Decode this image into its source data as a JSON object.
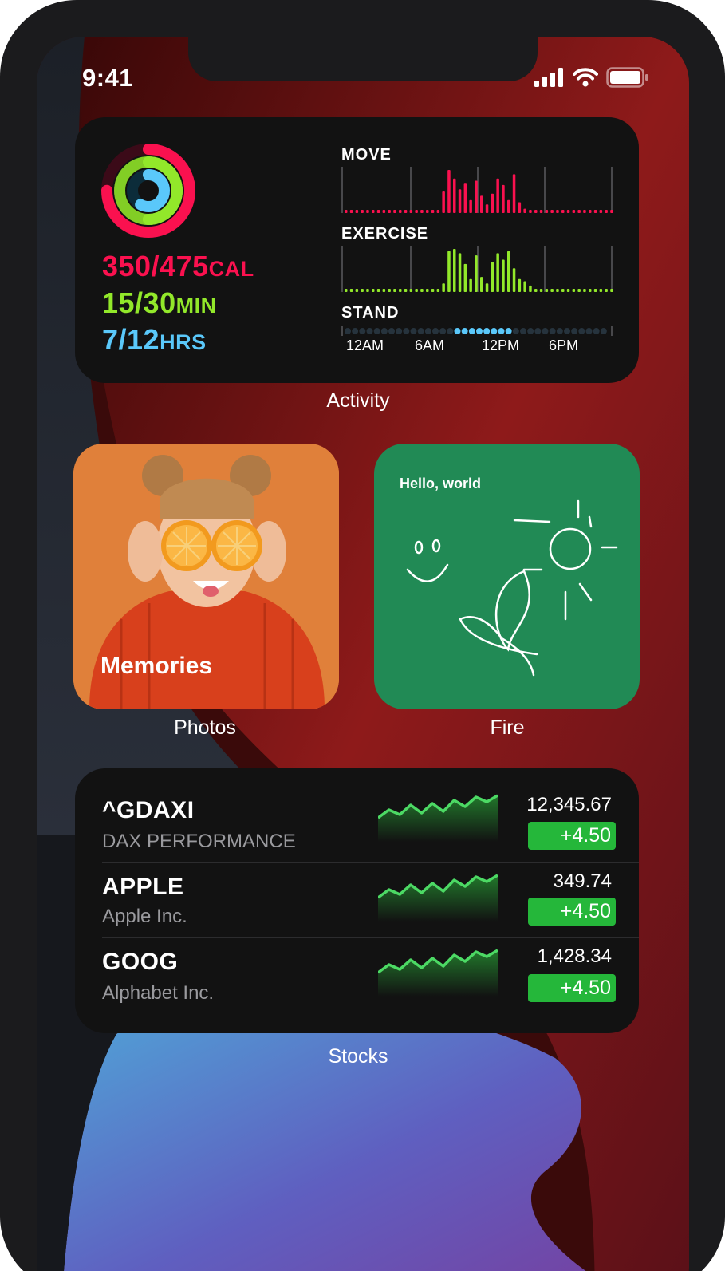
{
  "status_bar": {
    "time": "9:41"
  },
  "activity": {
    "label": "Activity",
    "move": {
      "value": "350/475",
      "unit": "CAL",
      "color": "#fa114f"
    },
    "exercise": {
      "value": "15/30",
      "unit": "MIN",
      "color": "#92e82a"
    },
    "stand": {
      "value": "7/12",
      "unit": "HRS",
      "color": "#5ac8fa"
    },
    "charts": {
      "move_title": "MOVE",
      "exercise_title": "EXERCISE",
      "stand_title": "STAND",
      "time_labels": [
        "12AM",
        "6AM",
        "12PM",
        "6PM"
      ],
      "move_bars": [
        0,
        0,
        0,
        0,
        0,
        0,
        0,
        0,
        0,
        0,
        0,
        0,
        0,
        0,
        0,
        0,
        0,
        0,
        0.5,
        1.0,
        0.8,
        0.55,
        0.7,
        0.3,
        0.75,
        0.4,
        0.2,
        0.45,
        0.8,
        0.65,
        0.3,
        0.9,
        0.25,
        0.1,
        0,
        0,
        0,
        0,
        0,
        0,
        0,
        0,
        0,
        0,
        0,
        0,
        0,
        0,
        0,
        0
      ],
      "exercise_bars": [
        0,
        0,
        0,
        0,
        0,
        0,
        0,
        0,
        0,
        0,
        0,
        0,
        0,
        0,
        0,
        0,
        0,
        0,
        0.2,
        0.95,
        1.0,
        0.9,
        0.65,
        0.3,
        0.85,
        0.35,
        0.2,
        0.7,
        0.9,
        0.75,
        0.95,
        0.55,
        0.3,
        0.25,
        0.15,
        0,
        0,
        0,
        0,
        0,
        0,
        0,
        0,
        0,
        0,
        0,
        0,
        0,
        0,
        0
      ],
      "stand_active": [
        0,
        0,
        0,
        0,
        0,
        0,
        0,
        0,
        0,
        0,
        0,
        0,
        0,
        0,
        0,
        1,
        1,
        1,
        1,
        1,
        1,
        1,
        1,
        0,
        0,
        0,
        0,
        0,
        0,
        0,
        0,
        0,
        0,
        0,
        0,
        0
      ]
    }
  },
  "photos": {
    "label": "Photos",
    "title": "Memories"
  },
  "fire": {
    "label": "Fire",
    "text": "Hello, world"
  },
  "stocks": {
    "label": "Stocks",
    "items": [
      {
        "symbol": "^GDAXI",
        "name": "DAX PERFORMANCE",
        "price": "12,345.67",
        "change": "+4.50"
      },
      {
        "symbol": "APPLE",
        "name": "Apple Inc.",
        "price": "349.74",
        "change": "+4.50"
      },
      {
        "symbol": "GOOG",
        "name": "Alphabet Inc.",
        "price": "1,428.34",
        "change": "+4.50"
      }
    ],
    "sparkline": [
      0.3,
      0.55,
      0.4,
      0.7,
      0.45,
      0.75,
      0.5,
      0.85,
      0.65,
      0.95,
      0.8,
      1.0
    ]
  },
  "colors": {
    "accent_green": "#25b73a",
    "fire_green": "#218a55",
    "photo_orange": "#e0803a"
  }
}
